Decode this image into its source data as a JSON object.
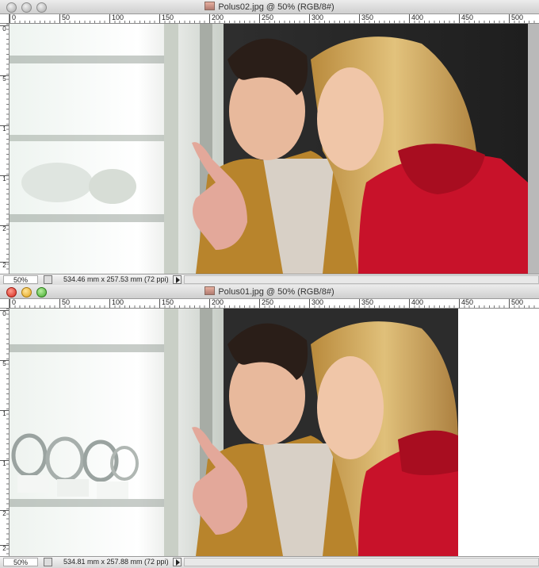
{
  "windows": [
    {
      "title": "Polus02.jpg @ 50% (RGB/8#)",
      "active": false,
      "zoom": "50%",
      "doc_size": "534.46 mm x 257.53 mm (72 ppi)"
    },
    {
      "title": "Polus01.jpg @ 50% (RGB/8#)",
      "active": true,
      "zoom": "50%",
      "doc_size": "534.81 mm x 257.88 mm (72 ppi)"
    }
  ],
  "ruler": {
    "h_labels": [
      "0",
      "50",
      "100",
      "150",
      "200",
      "250",
      "300",
      "350",
      "400",
      "450",
      "500"
    ],
    "v_labels": [
      "0",
      "5",
      "1",
      "1",
      "2",
      "2"
    ]
  },
  "colors": {
    "close": "#d3261a",
    "minimize": "#e2a41b",
    "zoom": "#41a82c",
    "inactive": "#a8a8a8"
  },
  "icons": {
    "status_nav": "page-nav-icon",
    "status_menu": "triangle-right-icon"
  }
}
